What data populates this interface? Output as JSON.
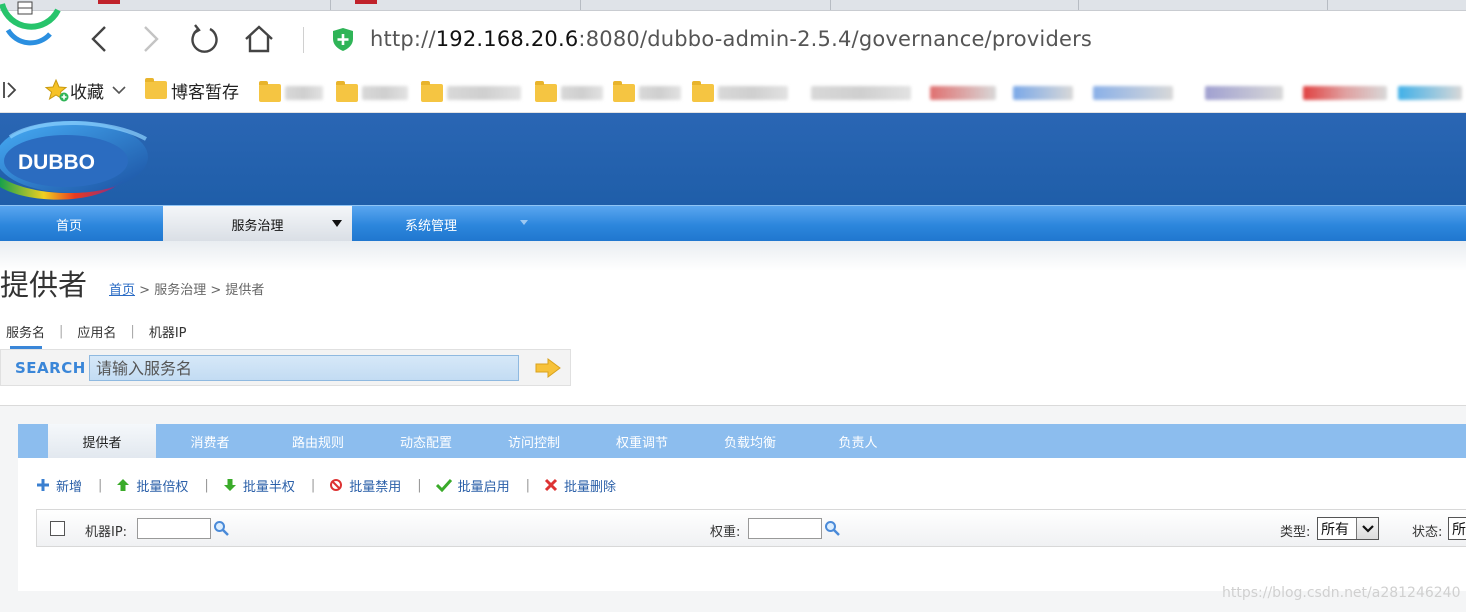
{
  "browser": {
    "url_scheme": "http://",
    "url_host": "192.168.20.6",
    "url_rest": ":8080/dubbo-admin-2.5.4/governance/providers"
  },
  "bookmarks": {
    "favorites_label": "收藏",
    "folder_1": "博客暂存"
  },
  "app": {
    "logo_text": "DUBBO",
    "nav": {
      "home": "首页",
      "service_governance": "服务治理",
      "system_management": "系统管理"
    }
  },
  "page": {
    "title": "提供者",
    "breadcrumb": {
      "home": "首页",
      "sep": ">",
      "section": "服务治理",
      "current": "提供者"
    }
  },
  "search": {
    "tabs": [
      "服务名",
      "应用名",
      "机器IP"
    ],
    "sep": "|",
    "label": "SEARCH",
    "placeholder": "请输入服务名"
  },
  "subtabs": [
    "提供者",
    "消费者",
    "路由规则",
    "动态配置",
    "访问控制",
    "权重调节",
    "负载均衡",
    "负责人"
  ],
  "actions": {
    "add": "新增",
    "double_weight": "批量倍权",
    "half_weight": "批量半权",
    "disable": "批量禁用",
    "enable": "批量启用",
    "delete": "批量删除",
    "sep": "|"
  },
  "filters": {
    "ip_label": "机器IP:",
    "weight_label": "权重:",
    "type_label": "类型:",
    "type_value": "所有",
    "status_label": "状态:",
    "status_value": "所"
  },
  "watermark": "https://blog.csdn.net/a281246240",
  "colors": {
    "header_blue": "#2162b0",
    "nav_blue": "#2c86dc",
    "subtab_blue": "#8cbdee",
    "link_blue": "#2a6bc4",
    "search_accent": "#3a86d8"
  }
}
